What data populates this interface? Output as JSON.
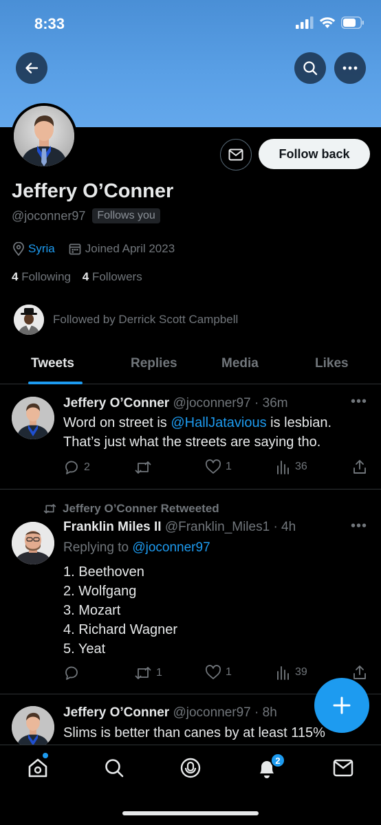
{
  "status": {
    "time": "8:33"
  },
  "profile": {
    "display_name": "Jeffery O’Conner",
    "handle": "@joconner97",
    "follows_you": "Follows you",
    "location": "Syria",
    "joined": "Joined April 2023",
    "following_count": "4",
    "following_label": "Following",
    "followers_count": "4",
    "followers_label": "Followers",
    "followed_by": "Followed by Derrick Scott Campbell",
    "follow_button": "Follow back"
  },
  "tabs": [
    {
      "label": "Tweets",
      "active": true
    },
    {
      "label": "Replies",
      "active": false
    },
    {
      "label": "Media",
      "active": false
    },
    {
      "label": "Likes",
      "active": false
    }
  ],
  "tweets": [
    {
      "name": "Jeffery O’Conner",
      "handle_time": "@joconner97 · 36m",
      "text_before": "Word on street is ",
      "mention": "@HallJatavious",
      "text_after": " is lesbian. That’s just what the streets are saying tho.",
      "replies": "2",
      "retweets": "",
      "likes": "1",
      "views": "36"
    },
    {
      "retweet_context": "Jeffery O’Conner Retweeted",
      "name": "Franklin Miles II",
      "handle_time": "@Franklin_Miles1 · 4h",
      "replying_label": "Replying to",
      "replying_to": "@joconner97",
      "lines": [
        "1. Beethoven",
        "2. Wolfgang",
        "3. Mozart",
        "4. Richard Wagner",
        "5. Yeat"
      ],
      "replies": "",
      "retweets": "1",
      "likes": "1",
      "views": "39"
    },
    {
      "name": "Jeffery O’Conner",
      "handle_time": "@joconner97 · 8h",
      "text": "Slims is better than canes by at least 115%"
    }
  ],
  "nav": {
    "notifications_badge": "2"
  },
  "colors": {
    "accent": "#1d9bf0",
    "banner": "#5aa0e6",
    "muted": "#71767b"
  }
}
